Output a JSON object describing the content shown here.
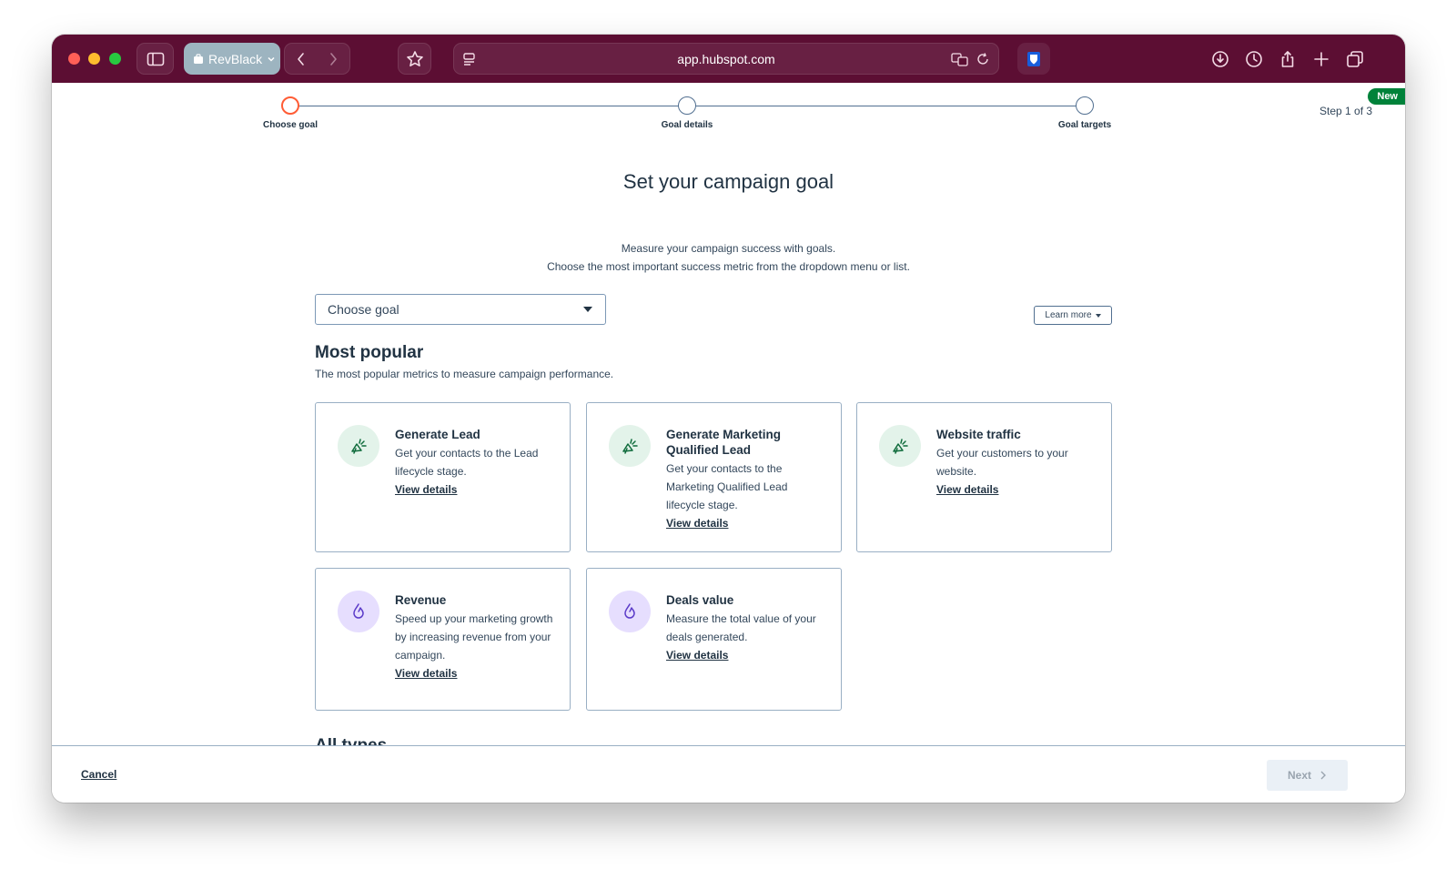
{
  "browser": {
    "profile_label": "RevBlack",
    "url": "app.hubspot.com"
  },
  "stepper": {
    "steps": [
      {
        "label": "Choose goal"
      },
      {
        "label": "Goal details"
      },
      {
        "label": "Goal targets"
      }
    ],
    "step_count": "Step 1 of 3",
    "new_badge": "New"
  },
  "page": {
    "title": "Set your campaign goal",
    "subtitle_line1": "Measure your campaign success with goals.",
    "subtitle_line2": "Choose the most important success metric from the dropdown menu or list."
  },
  "goal_select": {
    "value": "Choose goal"
  },
  "learn_more": "Learn more",
  "most_popular": {
    "heading": "Most popular",
    "description": "The most popular metrics to measure campaign performance.",
    "cards": [
      {
        "title": "Generate Lead",
        "description": "Get your contacts to the Lead lifecycle stage.",
        "link": "View details",
        "icon": "megaphone-icon"
      },
      {
        "title": "Generate Marketing Qualified Lead",
        "description": "Get your contacts to the Marketing Qualified Lead lifecycle stage.",
        "link": "View details",
        "icon": "megaphone-icon"
      },
      {
        "title": "Website traffic",
        "description": "Get your customers to your website.",
        "link": "View details",
        "icon": "megaphone-icon"
      },
      {
        "title": "Revenue",
        "description": "Speed up your marketing growth by increasing revenue from your campaign.",
        "link": "View details",
        "icon": "flame-icon"
      },
      {
        "title": "Deals value",
        "description": "Measure the total value of your deals generated.",
        "link": "View details",
        "icon": "flame-icon"
      }
    ]
  },
  "all_types": {
    "heading": "All types"
  },
  "footer": {
    "cancel": "Cancel",
    "next": "Next"
  },
  "colors": {
    "toolbar": "#5c0e33",
    "active_step": "#ff5c35",
    "badge_green": "#00823a",
    "icon_green_bg": "#e3f3ea",
    "icon_purple_bg": "#e6defe"
  }
}
